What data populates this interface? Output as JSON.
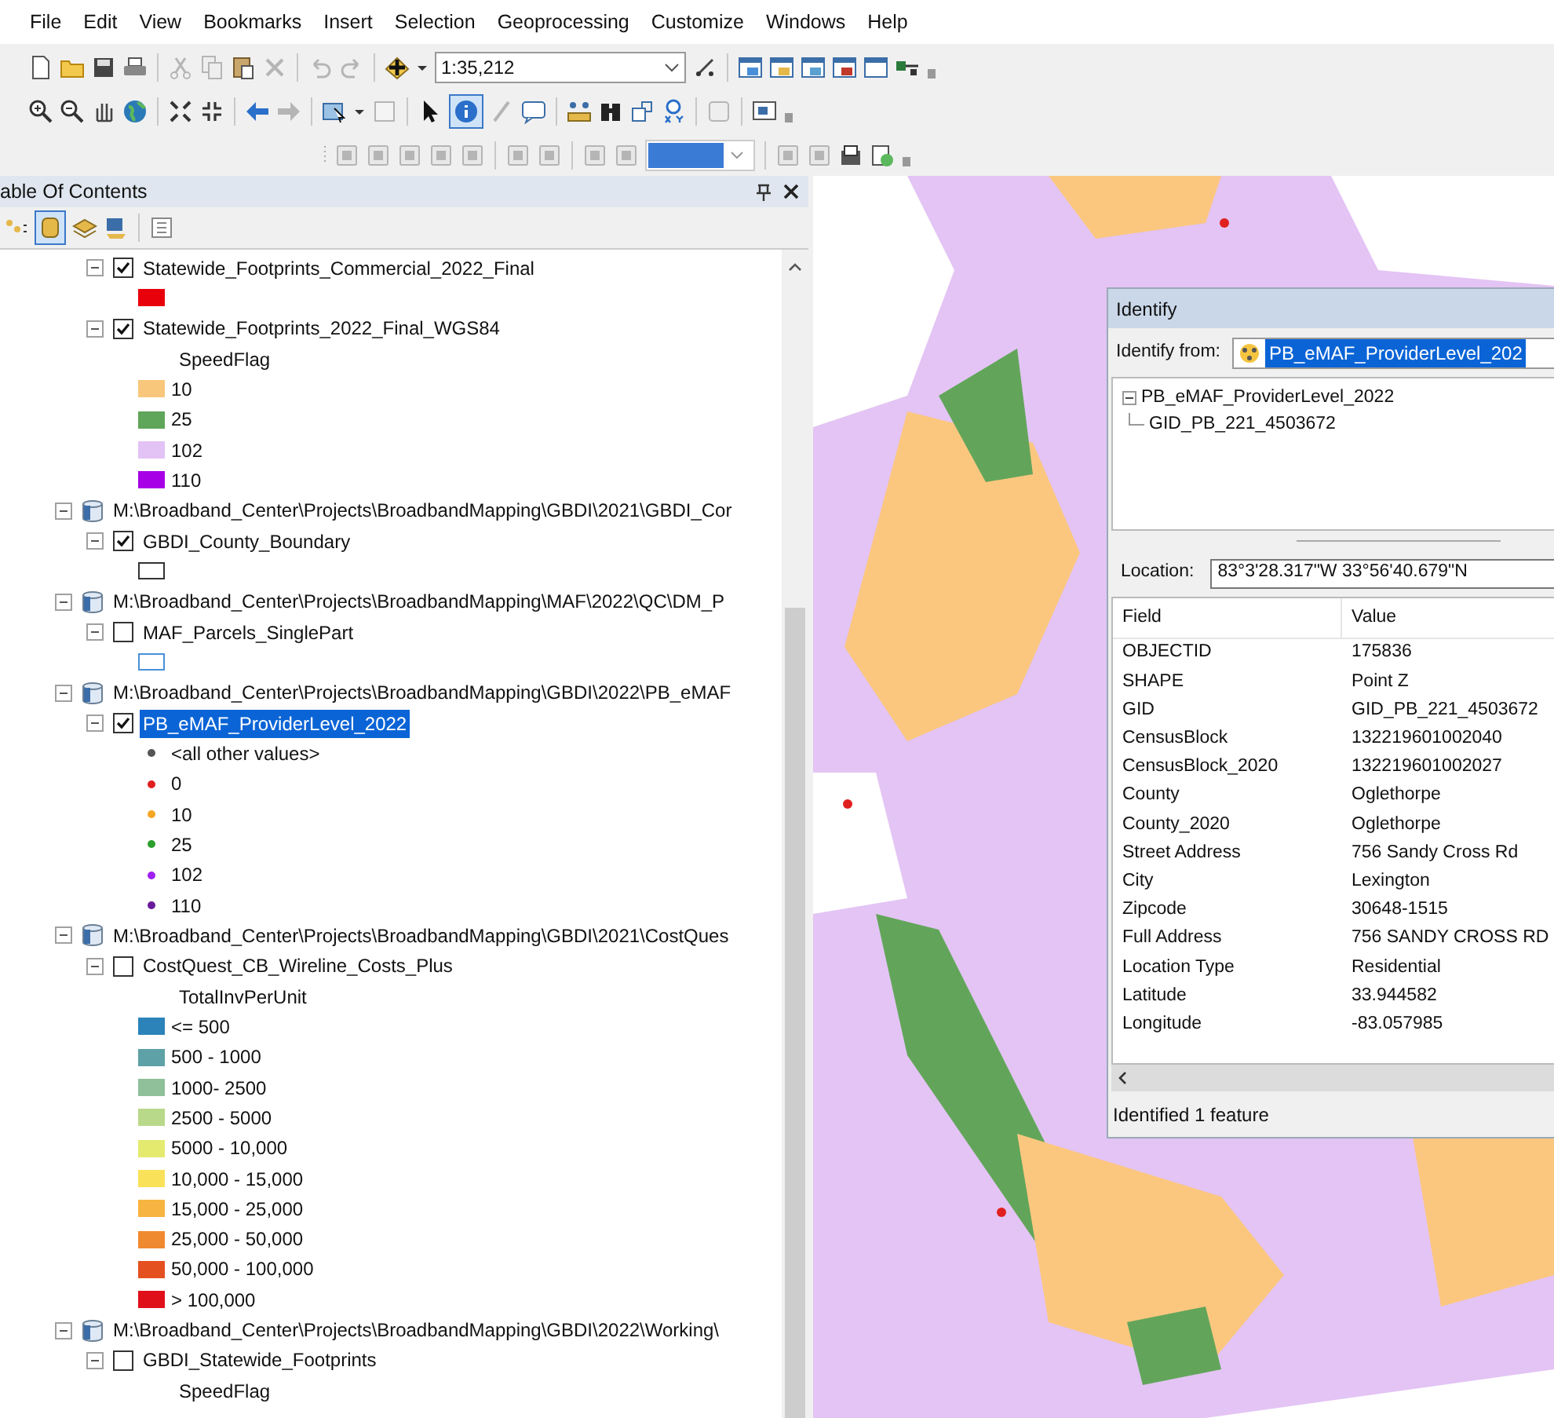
{
  "menu": [
    "File",
    "Edit",
    "View",
    "Bookmarks",
    "Insert",
    "Selection",
    "Geoprocessing",
    "Customize",
    "Windows",
    "Help"
  ],
  "toolbar": {
    "scale": "1:35,212",
    "identify_tool_selected": true
  },
  "toc": {
    "title": "able Of Contents",
    "tree": [
      {
        "kind": "layer",
        "label": "Statewide_Footprints_Commercial_2022_Final",
        "expanded": true,
        "checked": true,
        "selected": false,
        "legend": [
          {
            "kind": "swatch",
            "color": "#e8000b"
          }
        ]
      },
      {
        "kind": "layer",
        "label": "Statewide_Footprints_2022_Final_WGS84",
        "expanded": true,
        "checked": true,
        "selected": false,
        "legend": [
          {
            "kind": "heading",
            "label": "SpeedFlag"
          },
          {
            "kind": "swatch",
            "label": "10",
            "color": "#f9c77c"
          },
          {
            "kind": "swatch",
            "label": "25",
            "color": "#5fa55a"
          },
          {
            "kind": "swatch",
            "label": "102",
            "color": "#e3c2f5"
          },
          {
            "kind": "swatch",
            "label": "110",
            "color": "#a800e6"
          }
        ]
      },
      {
        "kind": "group",
        "label": "M:\\Broadband_Center\\Projects\\BroadbandMapping\\GBDI\\2021\\GBDI_Cor",
        "expanded": true
      },
      {
        "kind": "layer",
        "label": "GBDI_County_Boundary",
        "expanded": true,
        "checked": true,
        "selected": false,
        "legend": [
          {
            "kind": "outline",
            "color": "#333333"
          }
        ]
      },
      {
        "kind": "group",
        "label": "M:\\Broadband_Center\\Projects\\BroadbandMapping\\MAF\\2022\\QC\\DM_P",
        "expanded": true
      },
      {
        "kind": "layer",
        "label": "MAF_Parcels_SinglePart",
        "expanded": true,
        "checked": false,
        "selected": false,
        "legend": [
          {
            "kind": "outline",
            "color": "#4a90d9"
          }
        ]
      },
      {
        "kind": "group",
        "label": "M:\\Broadband_Center\\Projects\\BroadbandMapping\\GBDI\\2022\\PB_eMAF",
        "expanded": true
      },
      {
        "kind": "layer",
        "label": "PB_eMAF_ProviderLevel_2022",
        "expanded": true,
        "checked": true,
        "selected": true,
        "legend": [
          {
            "kind": "dot",
            "label": "<all other values>",
            "color": "#555555"
          },
          {
            "kind": "dot",
            "label": "0",
            "color": "#e02020"
          },
          {
            "kind": "dot",
            "label": "10",
            "color": "#f5a623"
          },
          {
            "kind": "dot",
            "label": "25",
            "color": "#2ca02c"
          },
          {
            "kind": "dot",
            "label": "102",
            "color": "#a020f0"
          },
          {
            "kind": "dot",
            "label": "110",
            "color": "#6a1b9a"
          }
        ]
      },
      {
        "kind": "group",
        "label": "M:\\Broadband_Center\\Projects\\BroadbandMapping\\GBDI\\2021\\CostQues",
        "expanded": true
      },
      {
        "kind": "layer",
        "label": "CostQuest_CB_Wireline_Costs_Plus",
        "expanded": true,
        "checked": false,
        "selected": false,
        "legend": [
          {
            "kind": "heading",
            "label": "TotalInvPerUnit"
          },
          {
            "kind": "swatch",
            "label": "<= 500",
            "color": "#2b83ba"
          },
          {
            "kind": "swatch",
            "label": "500 - 1000",
            "color": "#5ea1a6"
          },
          {
            "kind": "swatch",
            "label": "1000- 2500",
            "color": "#8fc09a"
          },
          {
            "kind": "swatch",
            "label": "2500 - 5000",
            "color": "#b9d98a"
          },
          {
            "kind": "swatch",
            "label": "5000 - 10,000",
            "color": "#e4ea6e"
          },
          {
            "kind": "swatch",
            "label": "10,000 - 15,000",
            "color": "#f9e15a"
          },
          {
            "kind": "swatch",
            "label": "15,000 - 25,000",
            "color": "#f8b440"
          },
          {
            "kind": "swatch",
            "label": "25,000 - 50,000",
            "color": "#f08a30"
          },
          {
            "kind": "swatch",
            "label": "50,000 - 100,000",
            "color": "#e55020"
          },
          {
            "kind": "swatch",
            "label": "> 100,000",
            "color": "#e0101a"
          }
        ]
      },
      {
        "kind": "group",
        "label": "M:\\Broadband_Center\\Projects\\BroadbandMapping\\GBDI\\2022\\Working\\",
        "expanded": true
      },
      {
        "kind": "layer",
        "label": "GBDI_Statewide_Footprints",
        "expanded": true,
        "checked": false,
        "selected": false,
        "legend": [
          {
            "kind": "heading",
            "label": "SpeedFlag"
          }
        ]
      }
    ]
  },
  "identify": {
    "title": "Identify",
    "from_label": "Identify from:",
    "from_value": "PB_eMAF_ProviderLevel_202",
    "tree": {
      "label": "PB_eMAF_ProviderLevel_2022",
      "expanded": true,
      "children": [
        {
          "label": "GID_PB_221_4503672"
        }
      ]
    },
    "location_label": "Location:",
    "location": "83°3'28.317\"W  33°56'40.679\"N",
    "columns": [
      "Field",
      "Value"
    ],
    "rows": [
      [
        "OBJECTID",
        "175836"
      ],
      [
        "SHAPE",
        "Point Z"
      ],
      [
        "GID",
        "GID_PB_221_4503672"
      ],
      [
        "CensusBlock",
        "132219601002040"
      ],
      [
        "CensusBlock_2020",
        "132219601002027"
      ],
      [
        "County",
        "Oglethorpe"
      ],
      [
        "County_2020",
        "Oglethorpe"
      ],
      [
        "Street Address",
        "756 Sandy Cross Rd"
      ],
      [
        "City",
        "Lexington"
      ],
      [
        "Zipcode",
        "30648-1515"
      ],
      [
        "Full Address",
        "756 SANDY CROSS RD"
      ],
      [
        "Location Type",
        "Residential"
      ],
      [
        "Latitude",
        "33.944582"
      ],
      [
        "Longitude",
        "-83.057985"
      ]
    ],
    "status": "Identified 1 feature"
  }
}
